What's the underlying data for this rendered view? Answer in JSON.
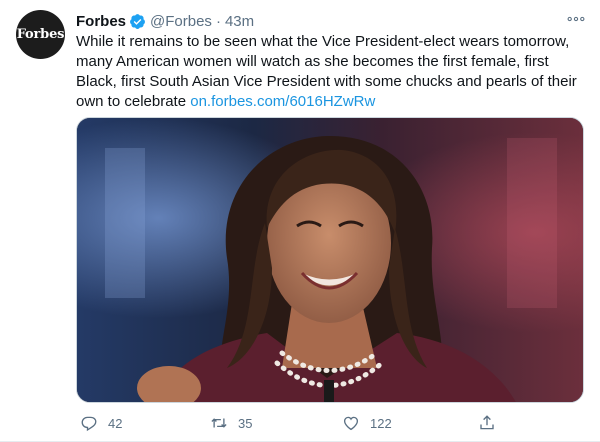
{
  "account": {
    "avatar_text": "Forbes",
    "name": "Forbes",
    "handle": "@Forbes",
    "separator": "·",
    "time": "43m"
  },
  "tweet": {
    "body": "While it remains to be seen what the Vice President-elect wears tomorrow,\nmany American women will watch as she becomes the first female, first\nBlack, first South Asian Vice President with some chucks and pearls of their\nown to celebrate ",
    "link": "on.forbes.com/6016HZwRw"
  },
  "actions": {
    "reply_count": "42",
    "retweet_count": "35",
    "like_count": "122"
  },
  "icons": {
    "verified": "verified-badge-icon",
    "more": "more-horizontal-icon",
    "reply": "reply-icon",
    "retweet": "retweet-icon",
    "like": "heart-icon",
    "share": "share-icon"
  },
  "colors": {
    "link": "#1b95e0",
    "secondary_text": "#5b7083",
    "verified": "#1da1f2"
  }
}
